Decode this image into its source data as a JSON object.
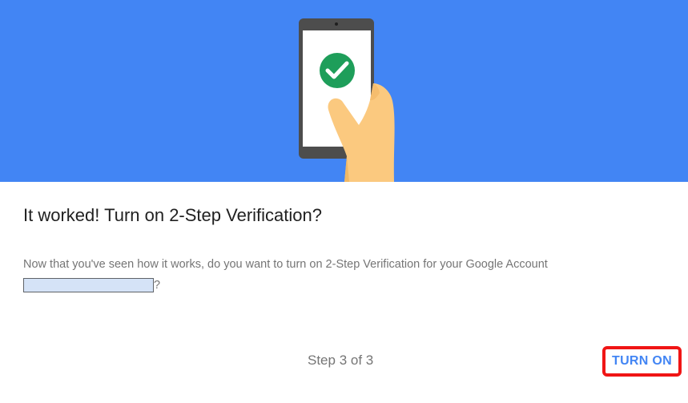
{
  "dialog": {
    "title": "It worked! Turn on 2-Step Verification?",
    "description": "Now that you've seen how it works, do you want to turn on 2-Step Verification for your Google Account",
    "account_suffix": "?",
    "step_indicator": "Step 3 of 3",
    "primary_button_label": "TURN ON"
  },
  "icons": {
    "hero_illustration": "phone-in-hand-with-checkmark",
    "check": "check-circle-icon"
  },
  "colors": {
    "hero_background": "#4285f4",
    "accent": "#4285f4",
    "check_green": "#1e9e5a",
    "highlight_border": "#f01515",
    "title_text": "#212121",
    "body_text": "#757575"
  }
}
